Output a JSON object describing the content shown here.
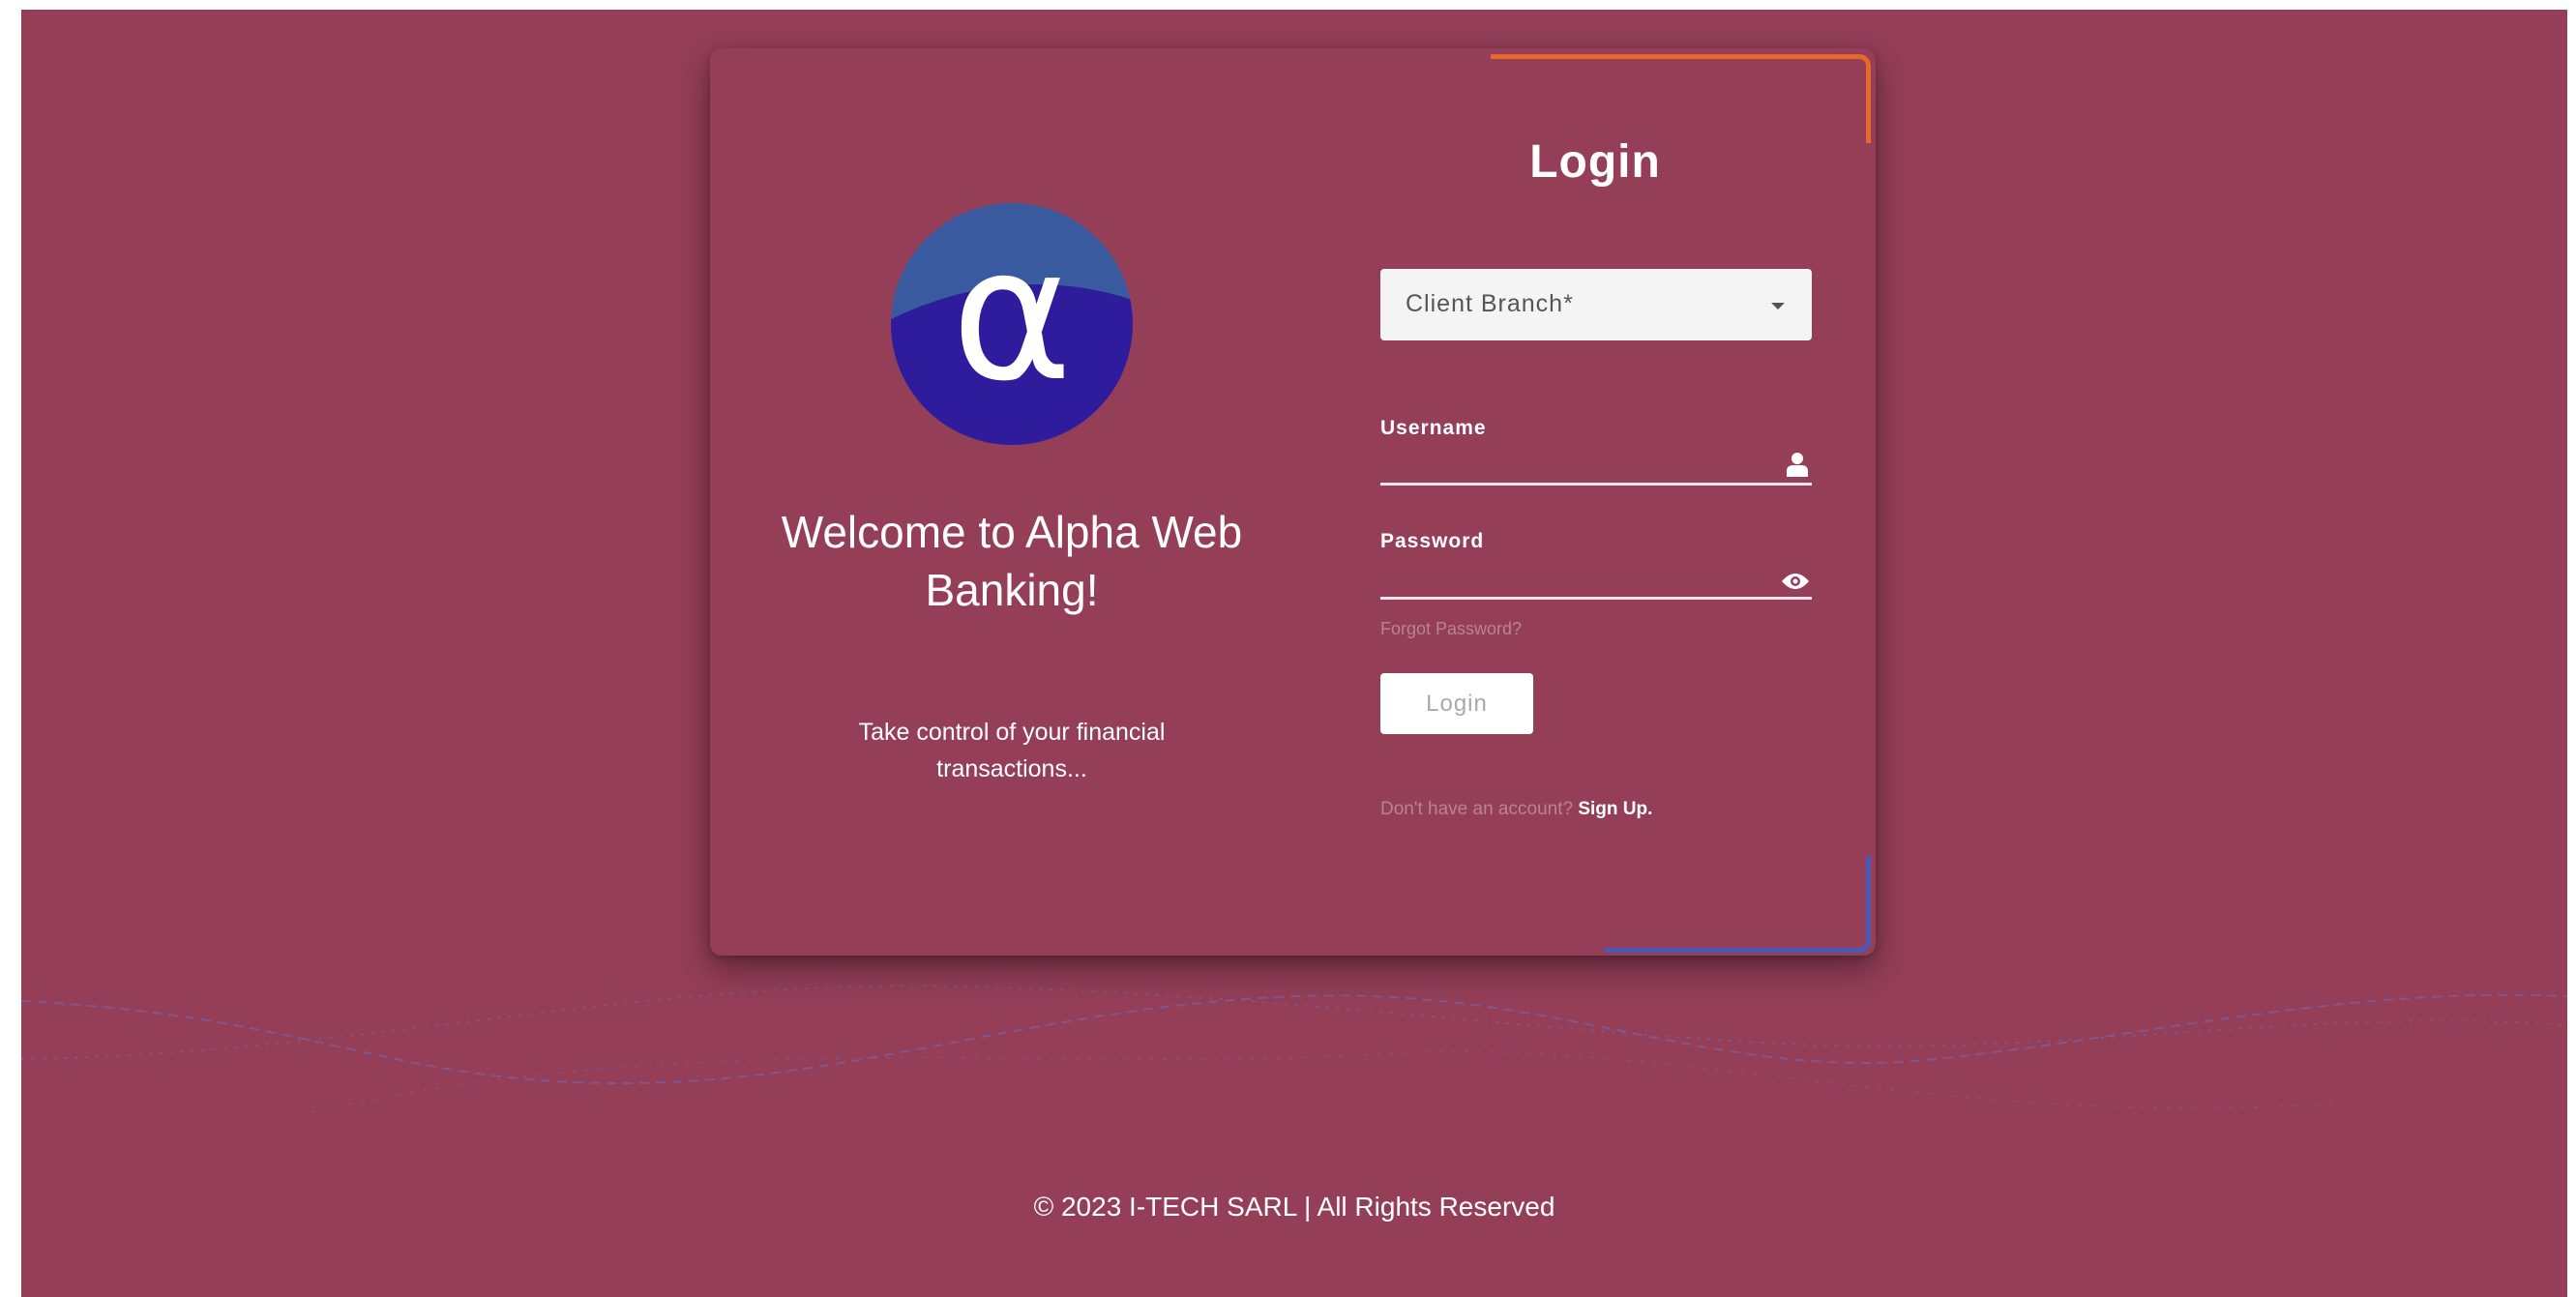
{
  "brand": {
    "logo_glyph": "α",
    "logo_icon": "alpha-logo-icon",
    "colors": {
      "background": "#943e58",
      "logo_top": "#3a5aa0",
      "logo_bottom": "#2e1c9c",
      "accent_orange": "#e8682a",
      "accent_blue": "#4c58b8"
    }
  },
  "welcome": {
    "title": "Welcome to Alpha Web Banking!",
    "tagline": "Take control of your financial transactions..."
  },
  "login_form": {
    "title": "Login",
    "branch_select": {
      "label": "Client Branch*",
      "icon": "chevron-down-icon"
    },
    "username": {
      "label": "Username",
      "value": "",
      "icon": "user-icon"
    },
    "password": {
      "label": "Password",
      "value": "",
      "icon": "eye-icon"
    },
    "forgot_password": "Forgot Password?",
    "submit_label": "Login",
    "signup_prompt": "Don't have an account?",
    "signup_link": "Sign Up."
  },
  "footer": {
    "copyright": "© 2023 I-TECH SARL | All Rights Reserved"
  }
}
